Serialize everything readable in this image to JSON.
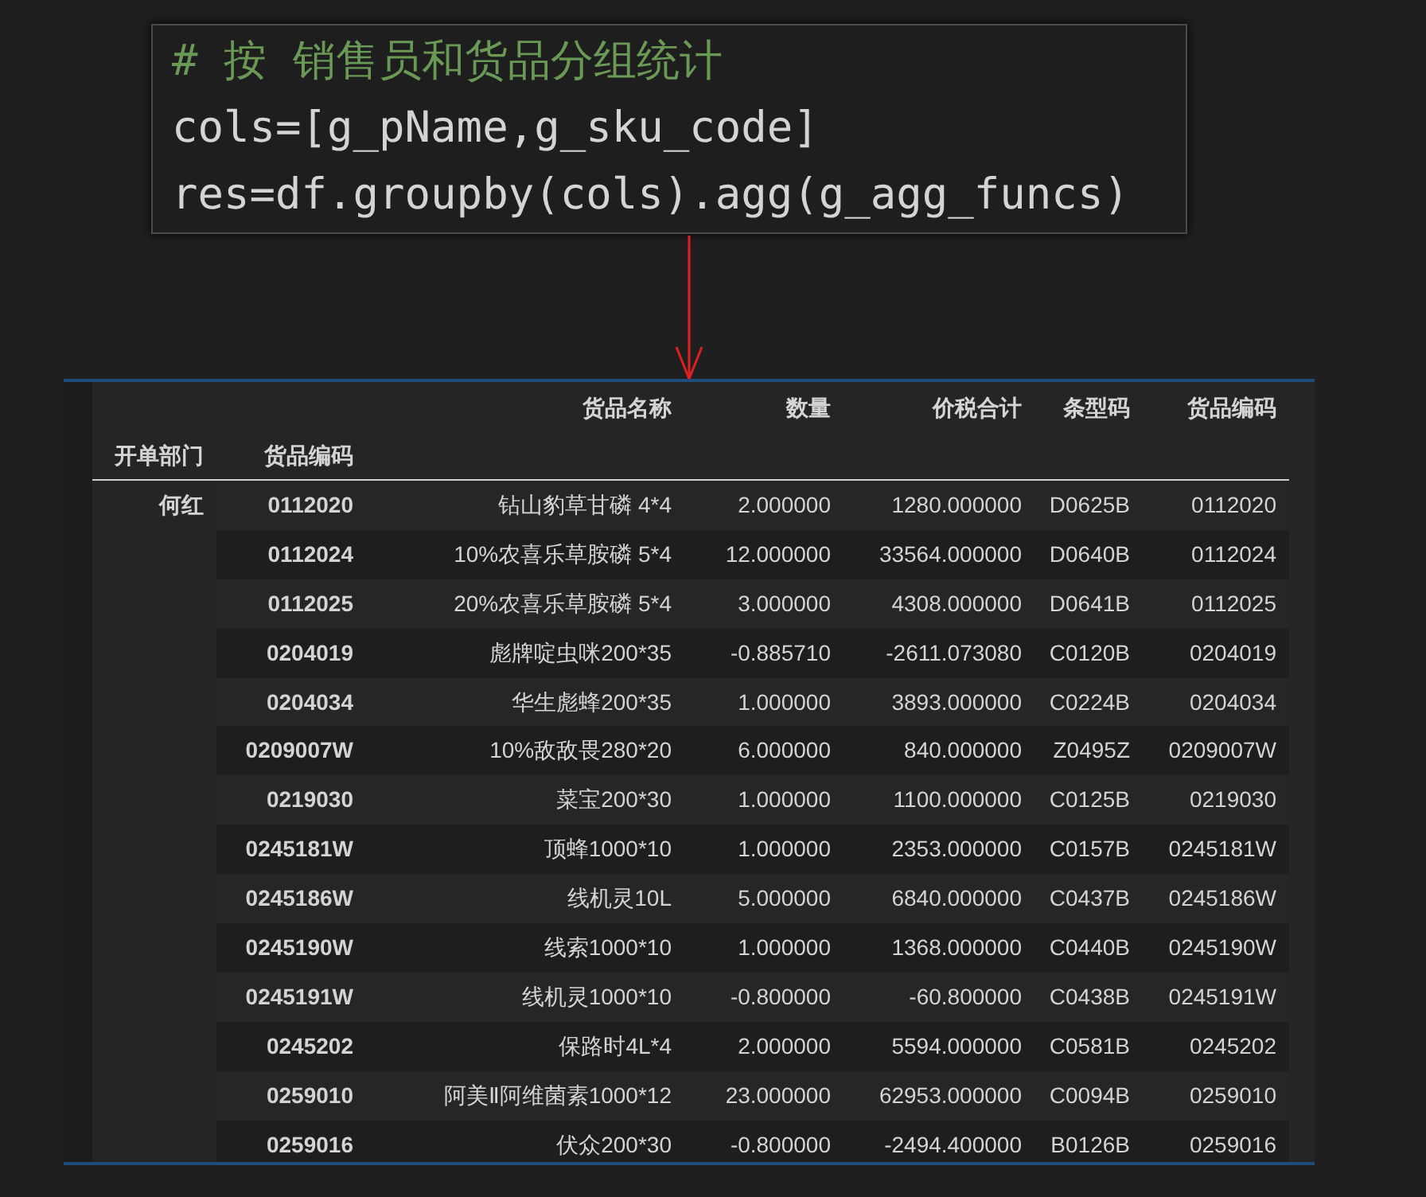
{
  "code_cell": {
    "lines": [
      {
        "kind": "comment",
        "text": "# 按 销售员和货品分组统计"
      },
      {
        "kind": "code",
        "text": "cols=[g_pName,g_sku_code]"
      },
      {
        "kind": "code",
        "text": "res=df.groupby(cols).agg(g_agg_funcs)"
      }
    ]
  },
  "table": {
    "columns": [
      "货品名称",
      "数量",
      "价税合计",
      "条型码",
      "货品编码"
    ],
    "index_names": [
      "开单部门",
      "货品编码"
    ],
    "rows": [
      {
        "group": "何红",
        "key": "0112020",
        "cells": [
          "钻山豹草甘磷 4*4",
          "2.000000",
          "1280.000000",
          "D0625B",
          "0112020"
        ]
      },
      {
        "key": "0112024",
        "cells": [
          "10%农喜乐草胺磷 5*4",
          "12.000000",
          "33564.000000",
          "D0640B",
          "0112024"
        ]
      },
      {
        "key": "0112025",
        "cells": [
          "20%农喜乐草胺磷 5*4",
          "3.000000",
          "4308.000000",
          "D0641B",
          "0112025"
        ]
      },
      {
        "key": "0204019",
        "cells": [
          "彪牌啶虫咪200*35",
          "-0.885710",
          "-2611.073080",
          "C0120B",
          "0204019"
        ]
      },
      {
        "key": "0204034",
        "cells": [
          "华生彪蜂200*35",
          "1.000000",
          "3893.000000",
          "C0224B",
          "0204034"
        ]
      },
      {
        "key": "0209007W",
        "cells": [
          "10%敌敌畏280*20",
          "6.000000",
          "840.000000",
          "Z0495Z",
          "0209007W"
        ]
      },
      {
        "key": "0219030",
        "cells": [
          "菜宝200*30",
          "1.000000",
          "1100.000000",
          "C0125B",
          "0219030"
        ]
      },
      {
        "key": "0245181W",
        "cells": [
          "顶蜂1000*10",
          "1.000000",
          "2353.000000",
          "C0157B",
          "0245181W"
        ]
      },
      {
        "key": "0245186W",
        "cells": [
          "线机灵10L",
          "5.000000",
          "6840.000000",
          "C0437B",
          "0245186W"
        ]
      },
      {
        "key": "0245190W",
        "cells": [
          "线索1000*10",
          "1.000000",
          "1368.000000",
          "C0440B",
          "0245190W"
        ]
      },
      {
        "key": "0245191W",
        "cells": [
          "线机灵1000*10",
          "-0.800000",
          "-60.800000",
          "C0438B",
          "0245191W"
        ]
      },
      {
        "key": "0245202",
        "cells": [
          "保路时4L*4",
          "2.000000",
          "5594.000000",
          "C0581B",
          "0245202"
        ]
      },
      {
        "key": "0259010",
        "cells": [
          "阿美Ⅱ阿维菌素1000*12",
          "23.000000",
          "62953.000000",
          "C0094B",
          "0259010"
        ]
      },
      {
        "key": "0259016",
        "cells": [
          "伏众200*30",
          "-0.800000",
          "-2494.400000",
          "B0126B",
          "0259016"
        ]
      }
    ]
  }
}
